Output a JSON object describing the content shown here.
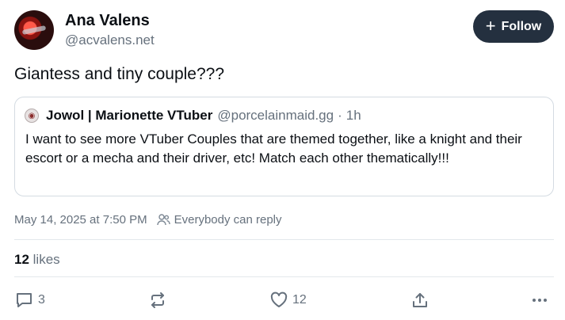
{
  "author": {
    "name": "Ana Valens",
    "handle": "@acvalens.net"
  },
  "follow_button": {
    "icon": "plus-icon",
    "label": "Follow"
  },
  "post": {
    "text": "Giantess and tiny couple???"
  },
  "quote": {
    "author_name": "Jowol | Marionette VTuber",
    "author_handle": "@porcelainmaid.gg",
    "separator": "·",
    "time": "1h",
    "text": "I want to see more VTuber Couples that are themed together, like a knight and their escort or a mecha and their driver, etc! Match each other thematically!!!"
  },
  "meta": {
    "timestamp": "May 14, 2025 at 7:50 PM",
    "reply_setting": "Everybody can reply"
  },
  "likes": {
    "count": "12",
    "label": "likes"
  },
  "actions": {
    "reply_count": "3",
    "like_count": "12"
  },
  "colors": {
    "follow_bg": "#24303f",
    "muted_text": "#66717d",
    "border": "#d4dbe2"
  }
}
